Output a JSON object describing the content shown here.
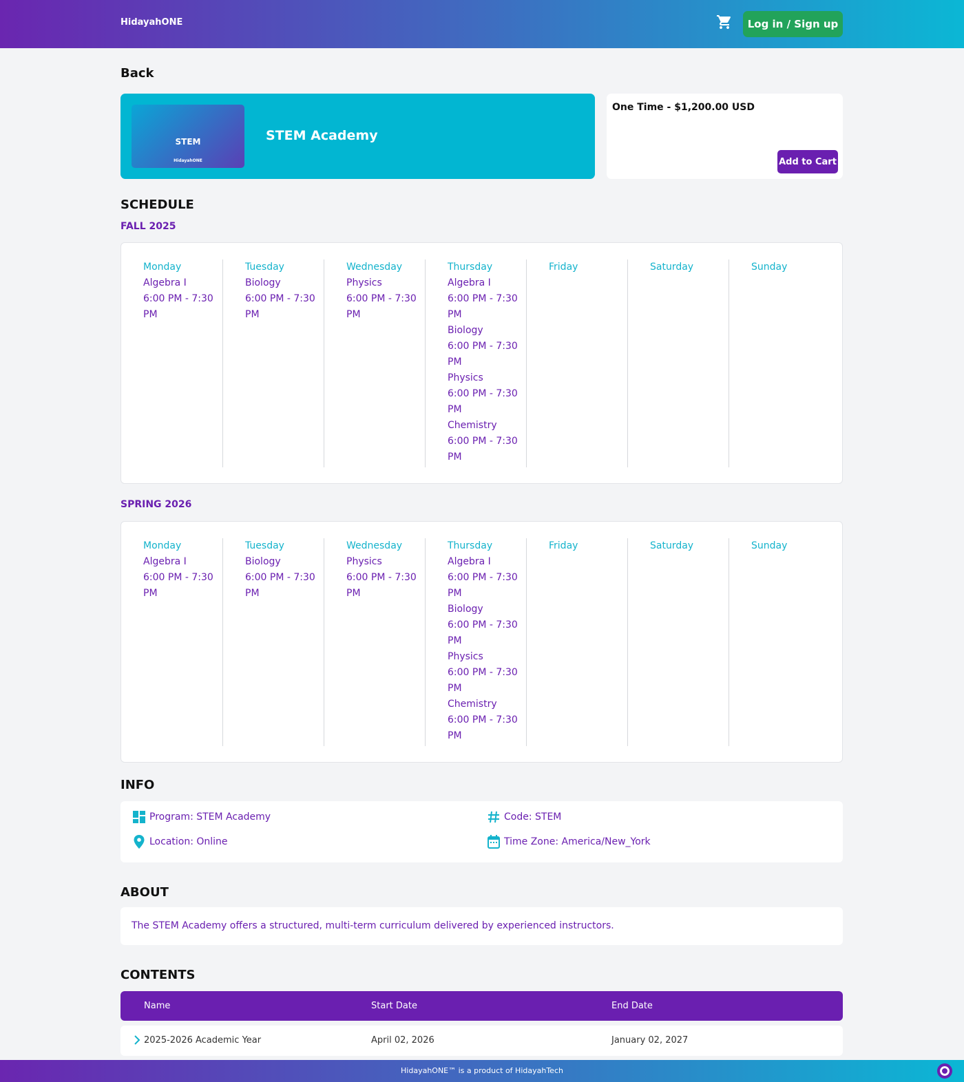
{
  "header": {
    "brand": "HidayahONE",
    "login_label": "Log in / Sign up"
  },
  "back_label": "Back",
  "hero": {
    "title": "STEM Academy",
    "thumb_title": "STEM",
    "thumb_brand": "HidayahONE"
  },
  "price": {
    "text": "One Time - $1,200.00 USD",
    "add_to_cart_label": "Add to Cart"
  },
  "schedule": {
    "heading": "SCHEDULE",
    "terms": [
      {
        "name": "FALL 2025",
        "days": [
          {
            "day": "Monday",
            "items": [
              {
                "course": "Algebra I",
                "time": "6:00 PM - 7:30 PM"
              }
            ]
          },
          {
            "day": "Tuesday",
            "items": [
              {
                "course": "Biology",
                "time": "6:00 PM - 7:30 PM"
              }
            ]
          },
          {
            "day": "Wednesday",
            "items": [
              {
                "course": "Physics",
                "time": "6:00 PM - 7:30 PM"
              }
            ]
          },
          {
            "day": "Thursday",
            "items": [
              {
                "course": "Algebra I",
                "time": "6:00 PM - 7:30 PM"
              },
              {
                "course": "Biology",
                "time": "6:00 PM - 7:30 PM"
              },
              {
                "course": "Physics",
                "time": "6:00 PM - 7:30 PM"
              },
              {
                "course": "Chemistry",
                "time": "6:00 PM - 7:30 PM"
              }
            ]
          },
          {
            "day": "Friday",
            "items": []
          },
          {
            "day": "Saturday",
            "items": []
          },
          {
            "day": "Sunday",
            "items": []
          }
        ]
      },
      {
        "name": "SPRING 2026",
        "days": [
          {
            "day": "Monday",
            "items": [
              {
                "course": "Algebra I",
                "time": "6:00 PM - 7:30 PM"
              }
            ]
          },
          {
            "day": "Tuesday",
            "items": [
              {
                "course": "Biology",
                "time": "6:00 PM - 7:30 PM"
              }
            ]
          },
          {
            "day": "Wednesday",
            "items": [
              {
                "course": "Physics",
                "time": "6:00 PM - 7:30 PM"
              }
            ]
          },
          {
            "day": "Thursday",
            "items": [
              {
                "course": "Algebra I",
                "time": "6:00 PM - 7:30 PM"
              },
              {
                "course": "Biology",
                "time": "6:00 PM - 7:30 PM"
              },
              {
                "course": "Physics",
                "time": "6:00 PM - 7:30 PM"
              },
              {
                "course": "Chemistry",
                "time": "6:00 PM - 7:30 PM"
              }
            ]
          },
          {
            "day": "Friday",
            "items": []
          },
          {
            "day": "Saturday",
            "items": []
          },
          {
            "day": "Sunday",
            "items": []
          }
        ]
      }
    ]
  },
  "info": {
    "heading": "INFO",
    "program": "Program: STEM Academy",
    "code": "Code: STEM",
    "location": "Location: Online",
    "timezone": "Time Zone: America/New_York"
  },
  "about": {
    "heading": "ABOUT",
    "text": "The STEM Academy offers a structured, multi-term curriculum delivered by experienced instructors."
  },
  "contents": {
    "heading": "CONTENTS",
    "columns": [
      "Name",
      "Start Date",
      "End Date"
    ],
    "rows": [
      {
        "name": "2025-2026 Academic Year",
        "start": "April 02, 2026",
        "end": "January 02, 2027"
      }
    ]
  },
  "footer": {
    "text": "HidayahONE™ is a product of HidayahTech"
  },
  "colors": {
    "primary_purple": "#6a1fb0",
    "accent_cyan": "#02b6d2",
    "login_green": "#22a35a"
  }
}
